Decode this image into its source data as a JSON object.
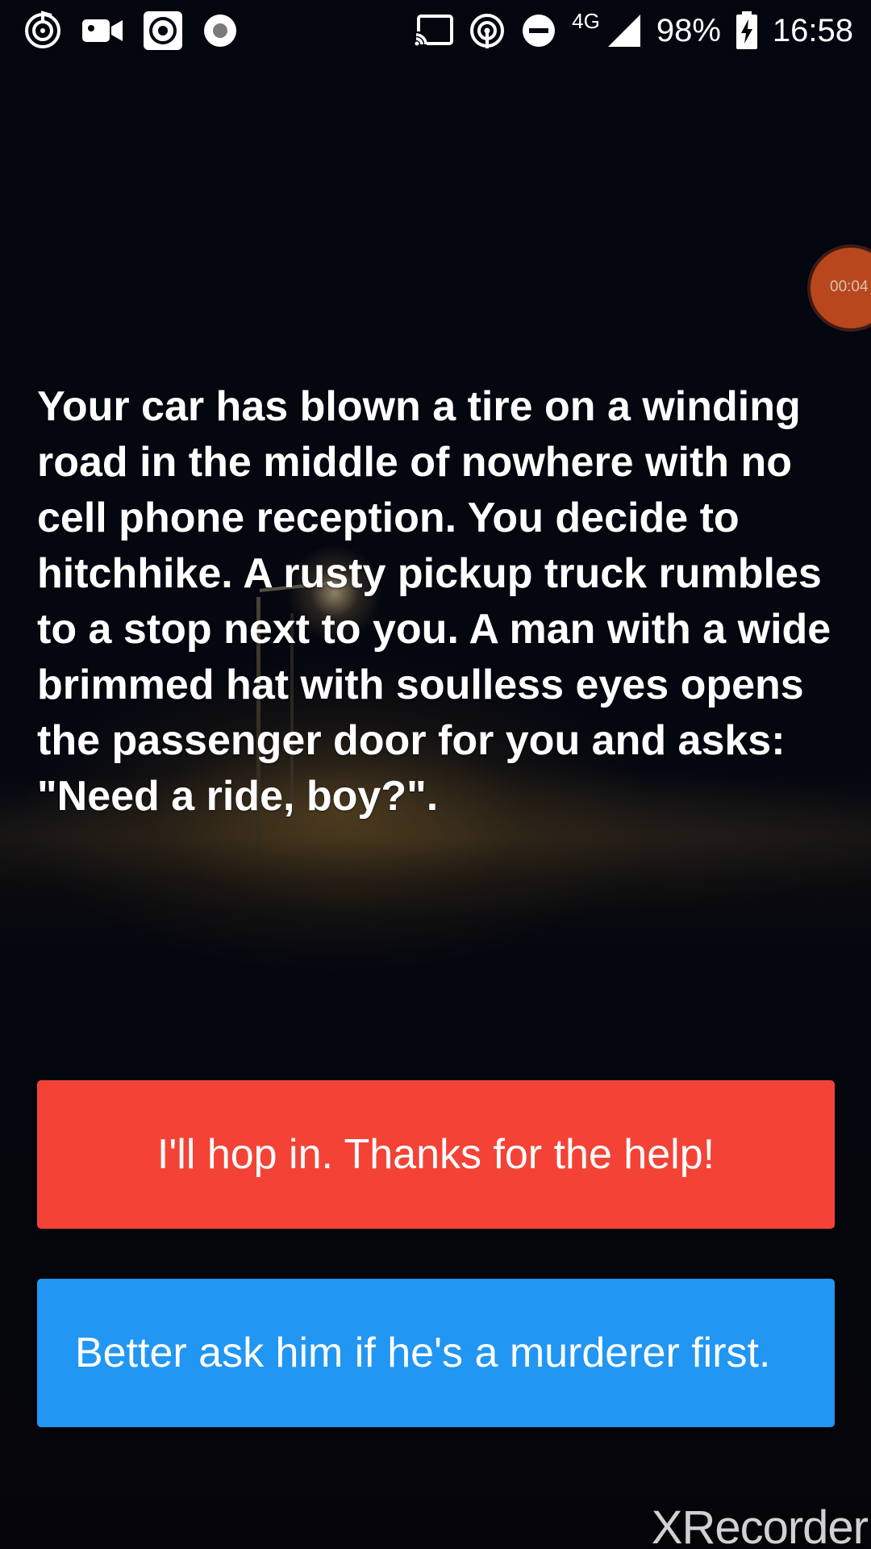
{
  "status_bar": {
    "network": "4G",
    "battery": "98%",
    "time": "16:58",
    "left_icons": [
      "music-app-icon",
      "video-camera-icon",
      "target-icon",
      "record-dot-icon"
    ],
    "right_icons": [
      "cast-icon",
      "hotspot-icon",
      "do-not-disturb-icon",
      "signal-icon",
      "battery-charging-icon"
    ]
  },
  "recorder": {
    "timer": "00:04"
  },
  "story": {
    "text": "Your car has blown a tire on a winding road in the middle of nowhere with no cell phone reception. You decide to hitchhike. A rusty pickup truck rumbles to a stop next to you. A man with a wide brimmed hat with soulless eyes opens the passenger door for you and asks: \"Need a ride, boy?\"."
  },
  "choices": [
    {
      "label": "I'll hop in. Thanks for the help!",
      "color": "#f44336"
    },
    {
      "label": "Better ask him if he's a murderer first.",
      "color": "#2196f3"
    }
  ],
  "watermark": {
    "text": "XRecorder"
  }
}
